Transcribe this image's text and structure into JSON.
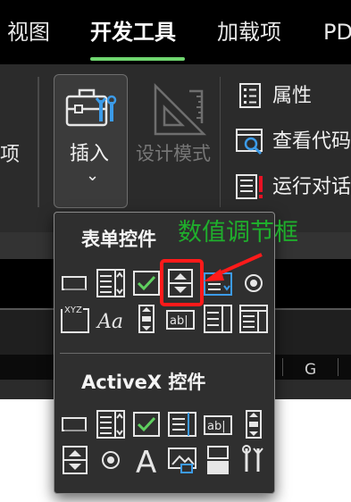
{
  "tabs": [
    {
      "label": "视图",
      "active": false
    },
    {
      "label": "开发工具",
      "active": true
    },
    {
      "label": "加载项",
      "active": false
    },
    {
      "label": "PD",
      "active": false
    }
  ],
  "ribbon": {
    "left_cut_label": "项",
    "insert_label": "插入",
    "insert_chevron": "⌄",
    "design_mode_label": "设计模式",
    "properties_label": "属性",
    "view_code_label": "查看代码",
    "run_dialog_label": "运行对话"
  },
  "dropdown": {
    "form_controls_title": "表单控件",
    "activex_title": "ActiveX 控件",
    "form_controls": [
      "button-icon",
      "combo-box-icon",
      "check-box-icon",
      "spin-button-icon",
      "list-box-icon",
      "option-button-icon",
      "group-box-icon",
      "label-icon",
      "scroll-bar-icon",
      "text-field-icon",
      "combo-list-icon",
      "combo-dropdown-icon"
    ],
    "activex_controls": [
      "command-button-icon",
      "combo-box-icon",
      "check-box-icon",
      "list-box-icon",
      "text-box-icon",
      "scroll-bar-icon",
      "spin-button-icon",
      "option-button-icon",
      "label-icon",
      "image-icon",
      "toggle-button-icon",
      "more-controls-icon"
    ]
  },
  "annotation": {
    "text": "数值调节框",
    "color": "#1fae2c",
    "highlight_color": "#ff1a1a"
  },
  "sheet": {
    "column_label": "G"
  }
}
